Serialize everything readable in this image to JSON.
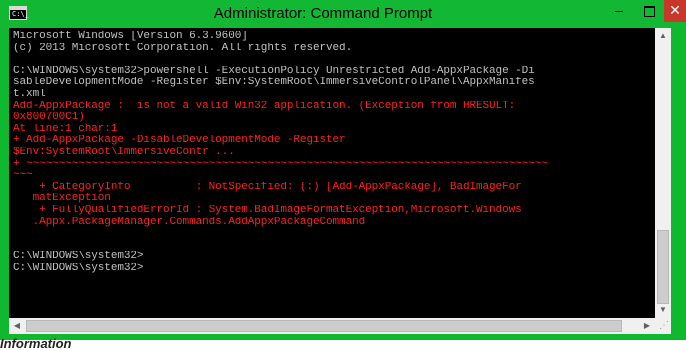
{
  "window": {
    "title": "Administrator: Command Prompt",
    "icon": "cmd-icon",
    "icon_text": "C:\\_",
    "accent": "#12b833",
    "close_color": "#c7382b",
    "controls": {
      "minimize": "–",
      "close": "✕"
    }
  },
  "console": {
    "lines": [
      {
        "text": "Microsoft Windows [Version 6.3.9600]",
        "color": "white"
      },
      {
        "text": "(c) 2013 Microsoft Corporation. All rights reserved.",
        "color": "white"
      },
      {
        "text": "",
        "color": "white"
      },
      {
        "text": "C:\\WINDOWS\\system32>powershell -ExecutionPolicy Unrestricted Add-AppxPackage -Di",
        "color": "white"
      },
      {
        "text": "sableDevelopmentMode -Register $Env:SystemRoot\\ImmersiveControlPanel\\AppxManifes",
        "color": "white"
      },
      {
        "text": "t.xml",
        "color": "white"
      },
      {
        "text": "Add-AppxPackage :  is not a valid Win32 application. (Exception from HRESULT:",
        "color": "red"
      },
      {
        "text": "0x800700C1)",
        "color": "red"
      },
      {
        "text": "At line:1 char:1",
        "color": "red"
      },
      {
        "text": "+ Add-AppxPackage -DisableDevelopmentMode -Register",
        "color": "red"
      },
      {
        "text": "$Env:SystemRoot\\ImmersiveContr ...",
        "color": "red"
      },
      {
        "text": "+ ~~~~~~~~~~~~~~~~~~~~~~~~~~~~~~~~~~~~~~~~~~~~~~~~~~~~~~~~~~~~~~~~~~~~~~~~~~~~~~~~",
        "color": "red"
      },
      {
        "text": "~~~",
        "color": "red"
      },
      {
        "text": "    + CategoryInfo          : NotSpecified: (:) [Add-AppxPackage], BadImageFor",
        "color": "red"
      },
      {
        "text": "   matException",
        "color": "red"
      },
      {
        "text": "    + FullyQualifiedErrorId : System.BadImageFormatException,Microsoft.Windows",
        "color": "red"
      },
      {
        "text": "   .Appx.PackageManager.Commands.AddAppxPackageCommand",
        "color": "red"
      },
      {
        "text": "",
        "color": "white"
      },
      {
        "text": "",
        "color": "white"
      },
      {
        "text": "C:\\WINDOWS\\system32>",
        "color": "white"
      },
      {
        "text": "C:\\WINDOWS\\system32>",
        "color": "white"
      }
    ],
    "text_colors": {
      "white": "#c0c0c0",
      "red": "#ff2020"
    }
  },
  "scrollbars": {
    "up_arrow": "▲",
    "down_arrow": "▼",
    "left_arrow": "◀",
    "right_arrow": "▶",
    "grip": "⋰"
  },
  "background_text": "Information"
}
